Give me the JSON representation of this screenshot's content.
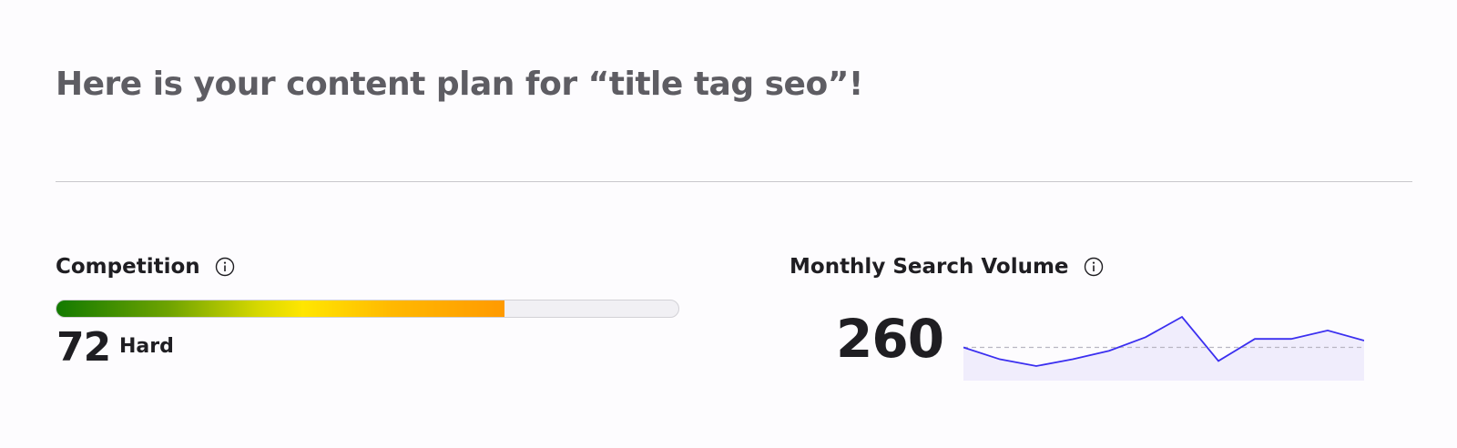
{
  "header": {
    "title": "Here is your content plan for “title tag seo”!"
  },
  "competition": {
    "label": "Competition",
    "score": "72",
    "level": "Hard",
    "fill_fraction": 0.72,
    "info_icon": "info-icon"
  },
  "search_volume": {
    "label": "Monthly Search Volume",
    "value": "260",
    "info_icon": "info-icon",
    "trend": [
      260,
      190,
      150,
      190,
      240,
      320,
      440,
      180,
      310,
      310,
      360,
      300
    ],
    "average": 260,
    "line_color": "#3b2ff0",
    "fill_color": "#ece8fb"
  },
  "colors": {
    "title": "#5e5d63",
    "text": "#1f1e22",
    "divider": "#c9c8cc",
    "bar_track": "#f1f0f4",
    "bar_start": "#137a00",
    "bar_mid": "#ffe600",
    "bar_end": "#ff9a00"
  }
}
